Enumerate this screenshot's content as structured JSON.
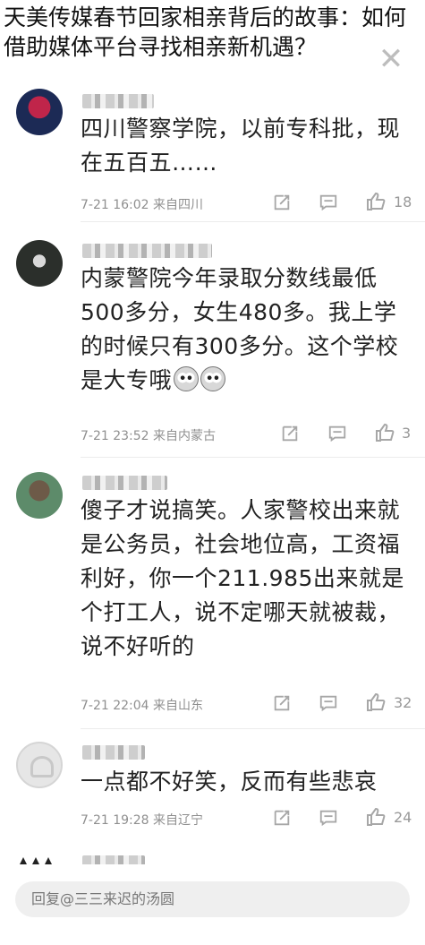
{
  "overlay": {
    "title_line1": "天美传媒春节回家相亲背后的故事：如何",
    "title_line2": "借助媒体平台寻找相亲新机遇？"
  },
  "comments": [
    {
      "text": "四川警察学院，以前专科批，现在五百五……",
      "time": "7-21 16:02",
      "location": "来自四川",
      "likes": "18"
    },
    {
      "text": "内蒙警院今年录取分数线最低500多分，女生480多。我上学的时候只有300多分。这个学校是大专哦",
      "time": "7-21 23:52",
      "location": "来自内蒙古",
      "likes": "3"
    },
    {
      "text": "傻子才说搞笑。人家警校出来就是公务员，社会地位高，工资福利好，你一个211.985出来就是个打工人，说不定哪天就被裁，说不好听的",
      "time": "7-21 22:04",
      "location": "来自山东",
      "likes": "32"
    },
    {
      "text": "一点都不好笑，反而有些悲哀",
      "time": "7-21 19:28",
      "location": "来自辽宁",
      "likes": "24"
    }
  ],
  "reply": {
    "placeholder": "回复@三三来迟的汤圆"
  },
  "icons": {
    "close": "close-icon",
    "share": "share-icon",
    "comment": "comment-icon",
    "like": "like-icon"
  }
}
